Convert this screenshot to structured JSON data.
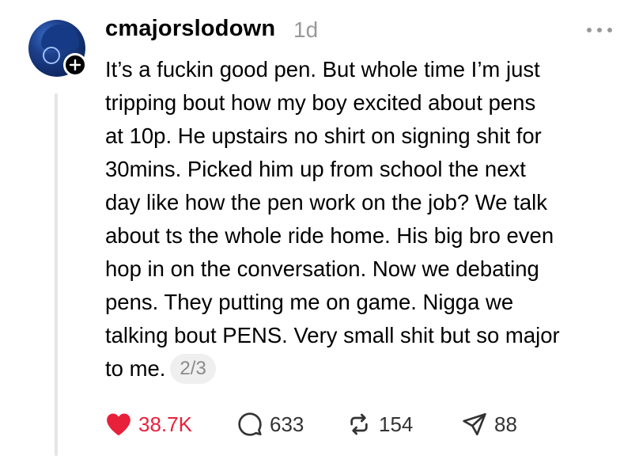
{
  "post": {
    "username": "cmajorslodown",
    "timestamp": "1d",
    "body_lines": [
      "It’s a fuckin good pen. But whole time I’m just",
      "tripping bout how my boy excited about pens",
      "at 10p. He upstairs no shirt on signing shit for",
      "30mins. Picked him up from school the next",
      "day like how the pen work on the job? We talk",
      "about ts the whole ride home. His big bro even",
      "hop in on the conversation. Now we debating",
      "pens. They putting me on game. Nigga we",
      "talking bout PENS. Very small shit but so major",
      "to me."
    ],
    "thread_position": "2/3"
  },
  "actions": {
    "like_count": "38.7K",
    "reply_count": "633",
    "repost_count": "154",
    "share_count": "88"
  },
  "icons": {
    "avatar": "avatar",
    "follow": "plus-icon",
    "more": "more-options-icon",
    "like": "heart-icon",
    "reply": "speech-bubble-icon",
    "repost": "repost-icon",
    "share": "paper-plane-icon"
  },
  "colors": {
    "like_active": "#e8213b",
    "muted_text": "#999999",
    "pill_bg": "#efefef"
  }
}
